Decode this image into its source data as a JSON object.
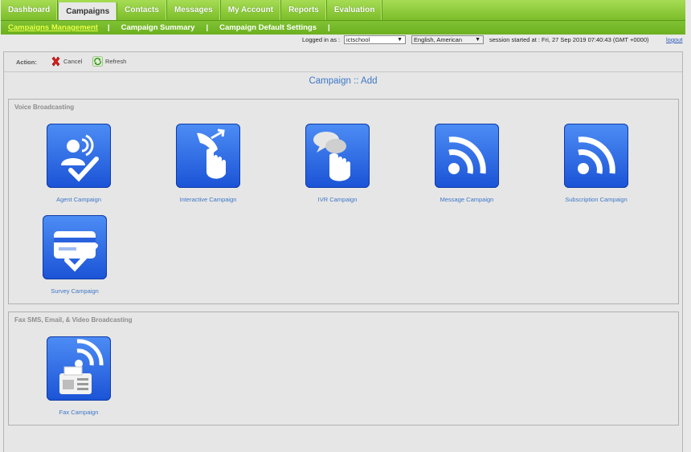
{
  "nav": {
    "tabs": [
      {
        "label": "Dashboard"
      },
      {
        "label": "Campaigns"
      },
      {
        "label": "Contacts"
      },
      {
        "label": "Messages"
      },
      {
        "label": "My Account"
      },
      {
        "label": "Reports"
      },
      {
        "label": "Evaluation"
      }
    ],
    "active_tab": "Campaigns"
  },
  "subnav": {
    "items": [
      {
        "label": "Campaigns Management"
      },
      {
        "label": "Campaign Summary"
      },
      {
        "label": "Campaign Default Settings"
      }
    ],
    "separator": "|"
  },
  "status": {
    "logged_in_label": "Logged in as :",
    "user_value": "ictschool",
    "language_value": "English, American",
    "session_text": "session started at : Fri, 27 Sep 2019 07:40:43 (GMT +0000)",
    "logout": "logout"
  },
  "actions": {
    "label": "Action:",
    "cancel": "Cancel",
    "refresh": "Refresh"
  },
  "page": {
    "title": "Campaign :: Add"
  },
  "sections": {
    "voice": {
      "title": "Voice Broadcasting",
      "tiles": [
        {
          "label": "Agent Campaign",
          "icon": "agent-campaign-icon"
        },
        {
          "label": "Interactive Campaign",
          "icon": "interactive-campaign-icon"
        },
        {
          "label": "IVR Campaign",
          "icon": "ivr-campaign-icon"
        },
        {
          "label": "Message Campaign",
          "icon": "message-campaign-icon"
        },
        {
          "label": "Subscription Campaign",
          "icon": "subscription-campaign-icon"
        },
        {
          "label": "Survey Campaign",
          "icon": "survey-campaign-icon"
        }
      ]
    },
    "fax": {
      "title": "Fax SMS, Email, & Video Broadcasting",
      "tiles": [
        {
          "label": "Fax Campaign",
          "icon": "fax-campaign-icon"
        }
      ]
    }
  },
  "colors": {
    "nav_green": "#7cbd2a",
    "active_sub": "#e9ff43",
    "link_blue": "#3d77c8",
    "tile_blue": "#1b53d6"
  }
}
